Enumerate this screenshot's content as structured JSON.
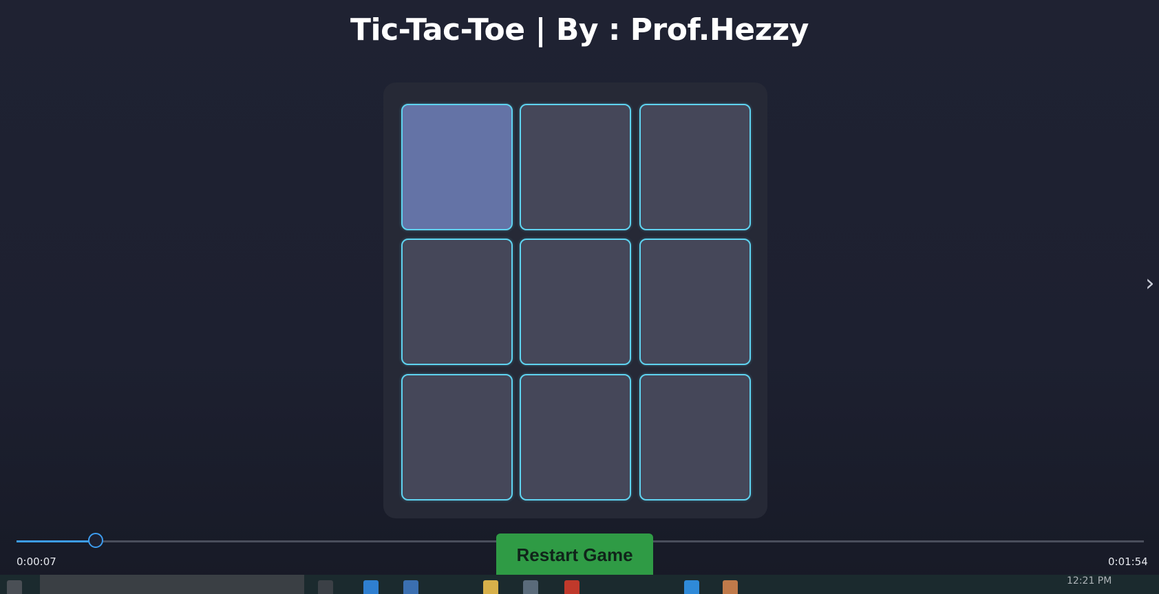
{
  "game": {
    "title": "Tic-Tac-Toe | By : Prof.Hezzy",
    "cells": [
      "",
      "",
      "",
      "",
      "",
      "",
      "",
      "",
      ""
    ],
    "highlighted_cell": 0,
    "restart_label": "Restart Game"
  },
  "player": {
    "current_time": "0:00:07",
    "total_time": "0:01:54",
    "progress": 0.07,
    "next_icon": "chevron-right-icon"
  },
  "taskbar": {
    "clock": "12:21 PM",
    "icons": [
      "windows-start-icon",
      "search-icon",
      "task-view-icon",
      "edge-icon",
      "folder-icon",
      "store-icon",
      "chrome-icon",
      "vscode-icon",
      "mail-icon"
    ]
  },
  "colors": {
    "cell_border": "#5fd3f0",
    "cell_fill": "#454759",
    "cell_hover": "#6473a6",
    "restart_button": "#2f9b45",
    "seek_accent": "#3d9df0"
  }
}
